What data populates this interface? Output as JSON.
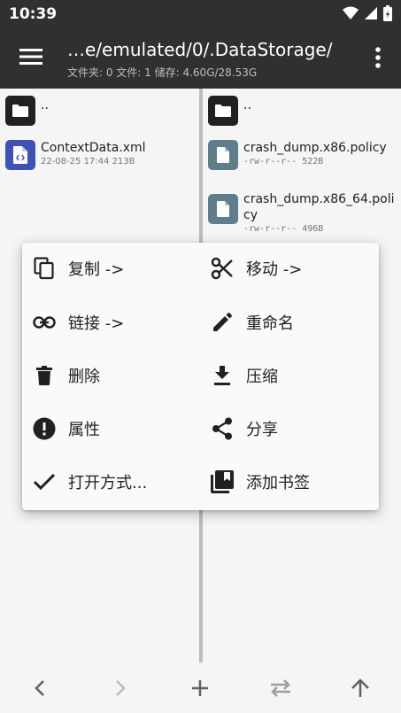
{
  "status": {
    "time": "10:39"
  },
  "appbar": {
    "path": "…e/emulated/0/.DataStorage/",
    "stats": "文件夹: 0  文件: 1  储存: 4.60G/28.53G"
  },
  "left_pane": {
    "parent": {
      "name": ".."
    },
    "files": [
      {
        "name": "ContextData.xml",
        "meta": "22-08-25 17:44  213B"
      }
    ]
  },
  "right_pane": {
    "parent": {
      "name": ".."
    },
    "files": [
      {
        "name": "crash_dump.x86.policy",
        "meta": "-rw-r--r--  522B"
      },
      {
        "name": "crash_dump.x86_64.poli",
        "name2": "cy",
        "meta": "-rw-r--r--  496B"
      }
    ]
  },
  "context_menu": {
    "items": [
      {
        "label": "复制 ->",
        "icon": "copy-icon"
      },
      {
        "label": "移动 ->",
        "icon": "scissors-icon"
      },
      {
        "label": "链接 ->",
        "icon": "link-icon"
      },
      {
        "label": "重命名",
        "icon": "pencil-icon"
      },
      {
        "label": "删除",
        "icon": "trash-icon"
      },
      {
        "label": "压缩",
        "icon": "download-icon"
      },
      {
        "label": "属性",
        "icon": "info-alert-icon"
      },
      {
        "label": "分享",
        "icon": "share-icon"
      },
      {
        "label": "打开方式...",
        "icon": "check-icon"
      },
      {
        "label": "添加书签",
        "icon": "bookmark-icon"
      }
    ]
  }
}
